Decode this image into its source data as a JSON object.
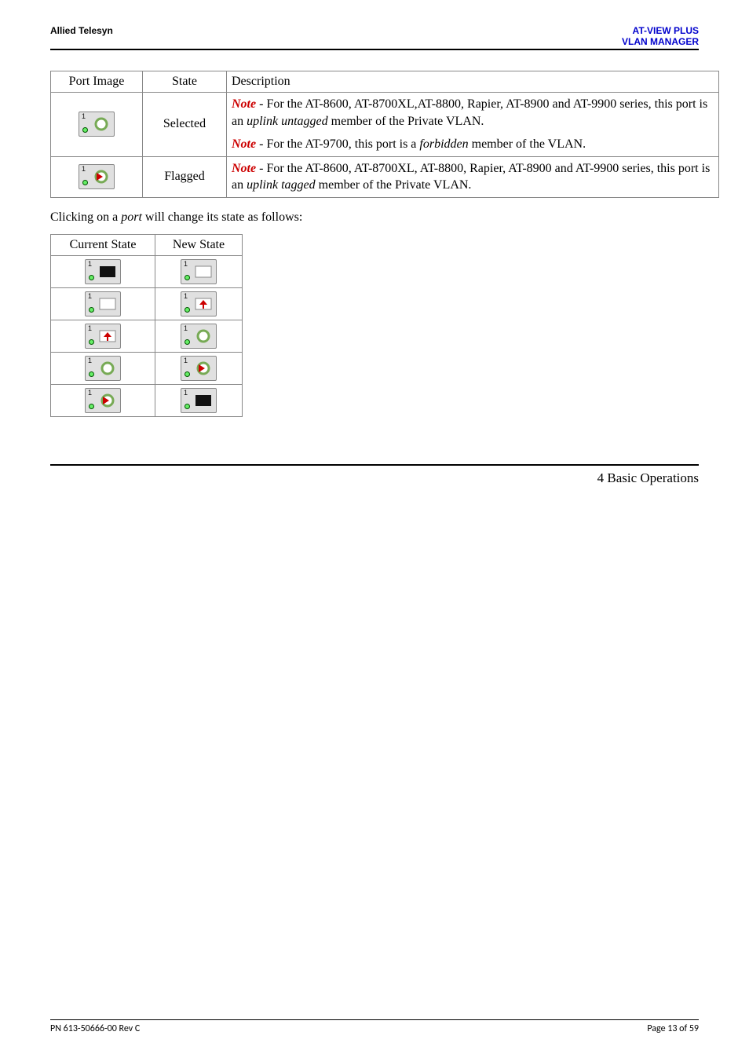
{
  "header": {
    "left": "Allied Telesyn",
    "right1": "AT-VIEW PLUS",
    "right2": "VLAN MANAGER"
  },
  "table1": {
    "headers": {
      "c1": "Port Image",
      "c2": "State",
      "c3": "Description"
    },
    "rows": [
      {
        "port_num": "1",
        "state": "Selected",
        "p1a": "Note",
        "p1b": " - For the AT-8600, AT-8700XL,AT-8800, Rapier, AT-8900 and AT-9900 series, this port is an ",
        "p1c": "uplink untagged",
        "p1d": " member of the Private VLAN.",
        "p2a": "Note",
        "p2b": " - For the AT-9700, this port is a ",
        "p2c": "forbidden",
        "p2d": " member of the VLAN."
      },
      {
        "port_num": "1",
        "state": "Flagged",
        "p1a": "Note",
        "p1b": " - For the AT-8600, AT-8700XL, AT-8800, Rapier, AT-8900 and AT-9900 series, this port is an ",
        "p1c": "uplink tagged",
        "p1d": " member of the Private VLAN."
      }
    ]
  },
  "paragraph": {
    "pre": "Clicking on a ",
    "ital": "port",
    "post": " will change its state as follows:"
  },
  "table2": {
    "headers": {
      "c1": "Current State",
      "c2": "New State"
    },
    "port_nums": {
      "r1c1": "1",
      "r1c2": "1",
      "r2c1": "1",
      "r2c2": "1",
      "r3c1": "1",
      "r3c2": "1",
      "r4c1": "1",
      "r4c2": "1",
      "r5c1": "1",
      "r5c2": "1"
    }
  },
  "section_title": "4 Basic Operations",
  "footer": {
    "left": "PN 613-50666-00 Rev C",
    "right": "Page 13 of 59"
  },
  "icons": {
    "port_black": "port-black-icon",
    "port_blank": "port-blank-icon",
    "port_pin": "port-pin-icon",
    "port_ring": "port-ring-icon",
    "port_flag": "port-flag-icon"
  }
}
